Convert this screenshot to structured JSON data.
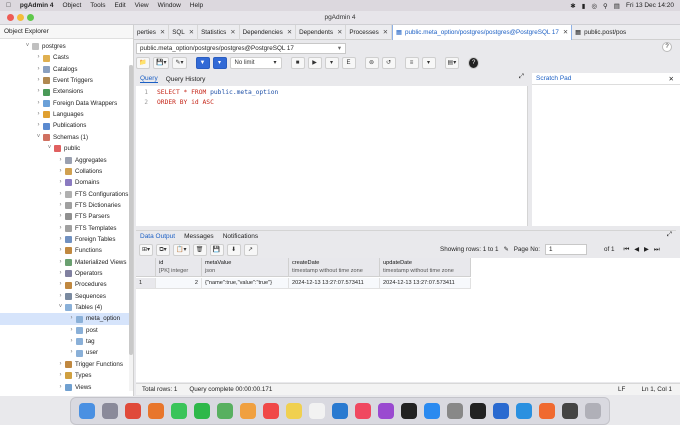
{
  "menubar": {
    "app": "pgAdmin 4",
    "items": [
      "Object",
      "Tools",
      "Edit",
      "View",
      "Window",
      "Help"
    ],
    "clock": "Fri 13 Dec 14:20"
  },
  "window": {
    "title": "pgAdmin 4"
  },
  "explorer": {
    "title": "Object Explorer",
    "tree": [
      {
        "label": "postgres",
        "depth": 1,
        "color": "#c0c0c0",
        "caret": "v"
      },
      {
        "label": "Casts",
        "depth": 2,
        "color": "#e0b050",
        "caret": ">"
      },
      {
        "label": "Catalogs",
        "depth": 2,
        "color": "#8aa0c0",
        "caret": ">"
      },
      {
        "label": "Event Triggers",
        "depth": 2,
        "color": "#b08850",
        "caret": ">"
      },
      {
        "label": "Extensions",
        "depth": 2,
        "color": "#4a9a58",
        "caret": ">"
      },
      {
        "label": "Foreign Data Wrappers",
        "depth": 2,
        "color": "#6aa0d8",
        "caret": ">"
      },
      {
        "label": "Languages",
        "depth": 2,
        "color": "#e0a030",
        "caret": ">"
      },
      {
        "label": "Publications",
        "depth": 2,
        "color": "#5a8ad0",
        "caret": ">"
      },
      {
        "label": "Schemas (1)",
        "depth": 2,
        "color": "#d07060",
        "caret": "v"
      },
      {
        "label": "public",
        "depth": 3,
        "color": "#e06060",
        "caret": "v"
      },
      {
        "label": "Aggregates",
        "depth": 4,
        "color": "#9aa0b0",
        "caret": ">"
      },
      {
        "label": "Collations",
        "depth": 4,
        "color": "#d0a050",
        "caret": ">"
      },
      {
        "label": "Domains",
        "depth": 4,
        "color": "#8a7ac0",
        "caret": ">"
      },
      {
        "label": "FTS Configurations",
        "depth": 4,
        "color": "#b0b0b0",
        "caret": ">"
      },
      {
        "label": "FTS Dictionaries",
        "depth": 4,
        "color": "#a0a0a0",
        "caret": ">"
      },
      {
        "label": "FTS Parsers",
        "depth": 4,
        "color": "#909090",
        "caret": ">"
      },
      {
        "label": "FTS Templates",
        "depth": 4,
        "color": "#a0a0a0",
        "caret": ">"
      },
      {
        "label": "Foreign Tables",
        "depth": 4,
        "color": "#7090c0",
        "caret": ">"
      },
      {
        "label": "Functions",
        "depth": 4,
        "color": "#c08840",
        "caret": ">"
      },
      {
        "label": "Materialized Views",
        "depth": 4,
        "color": "#6aa070",
        "caret": ">"
      },
      {
        "label": "Operators",
        "depth": 4,
        "color": "#8080a0",
        "caret": ">"
      },
      {
        "label": "Procedures",
        "depth": 4,
        "color": "#c08840",
        "caret": ">"
      },
      {
        "label": "Sequences",
        "depth": 4,
        "color": "#7a8aa0",
        "caret": ">"
      },
      {
        "label": "Tables (4)",
        "depth": 4,
        "color": "#8ab0d8",
        "caret": "v"
      },
      {
        "label": "meta_option",
        "depth": 5,
        "color": "#8ab0d8",
        "caret": ">",
        "selected": true
      },
      {
        "label": "post",
        "depth": 5,
        "color": "#8ab0d8",
        "caret": ">"
      },
      {
        "label": "tag",
        "depth": 5,
        "color": "#8ab0d8",
        "caret": ">"
      },
      {
        "label": "user",
        "depth": 5,
        "color": "#8ab0d8",
        "caret": ">"
      },
      {
        "label": "Trigger Functions",
        "depth": 4,
        "color": "#c08840",
        "caret": ">"
      },
      {
        "label": "Types",
        "depth": 4,
        "color": "#d0a040",
        "caret": ">"
      },
      {
        "label": "Views",
        "depth": 4,
        "color": "#70a0d0",
        "caret": ">"
      }
    ]
  },
  "tabs": [
    {
      "label": "perties",
      "active": false
    },
    {
      "label": "SQL",
      "active": false
    },
    {
      "label": "Statistics",
      "active": false
    },
    {
      "label": "Dependencies",
      "active": false
    },
    {
      "label": "Dependents",
      "active": false
    },
    {
      "label": "Processes",
      "active": false
    },
    {
      "label": "public.meta_option/postgres/postgres@PostgreSQL 17",
      "active": true
    },
    {
      "label": "public.post/pos",
      "active": false
    }
  ],
  "connection": {
    "label": "public.meta_option/postgres/postgres@PostgreSQL 17",
    "help": "?"
  },
  "toolbar": {
    "limit": "No limit"
  },
  "query": {
    "tabs": [
      "Query",
      "Query History"
    ],
    "lines": [
      {
        "num": "1",
        "parts": [
          {
            "t": "SELECT * FROM ",
            "c": "kw"
          },
          {
            "t": "public.meta_option",
            "c": "tbl"
          }
        ]
      },
      {
        "num": "2",
        "parts": [
          {
            "t": "ORDER BY id ASC",
            "c": "kw"
          }
        ]
      }
    ]
  },
  "scratch": {
    "title": "Scratch Pad"
  },
  "output": {
    "tabs": [
      "Data Output",
      "Messages",
      "Notifications"
    ],
    "rows_label": "Showing rows: 1 to 1",
    "page_label": "Page No:",
    "page_value": "1",
    "of_label": "of 1",
    "columns": [
      {
        "name": "id",
        "type": "[PK] integer"
      },
      {
        "name": "metaValue",
        "type": "json"
      },
      {
        "name": "createDate",
        "type": "timestamp without time zone"
      },
      {
        "name": "updateDate",
        "type": "timestamp without time zone"
      }
    ],
    "rows": [
      {
        "num": "1",
        "cells": [
          "2",
          "{\"name\":true,\"value\":\"true\"}",
          "2024-12-13 13:27:07.573411",
          "2024-12-13 13:27:07.573411"
        ]
      }
    ]
  },
  "status": {
    "total": "Total rows: 1",
    "query": "Query complete 00:00:00.171",
    "eol": "LF",
    "pos": "Ln 1, Col 1"
  },
  "dock": {
    "icons": [
      "finder-icon",
      "launchpad-icon",
      "chrome-icon",
      "firefox-icon",
      "messages-icon",
      "facetime-icon",
      "maps-icon",
      "photos-icon",
      "calendar-icon",
      "notes-icon",
      "reminders-icon",
      "vscode-icon",
      "music-icon",
      "podcasts-icon",
      "tv-icon",
      "app-store-icon",
      "settings-icon",
      "terminal-icon",
      "pgadmin-icon",
      "docker-icon",
      "postman-icon",
      "screenshot-icon",
      "trash-icon"
    ],
    "colors": [
      "#4a90e2",
      "#8a8a9a",
      "#e04a3a",
      "#e8762c",
      "#3ac45a",
      "#2eb84a",
      "#58b060",
      "#f0a040",
      "#f04848",
      "#f0d050",
      "#f2f2f2",
      "#2a7ad0",
      "#f04860",
      "#9a4ad0",
      "#222222",
      "#2a8af0",
      "#888888",
      "#222222",
      "#2a6ad0",
      "#2a90e0",
      "#f06a30",
      "#444444",
      "#b0b0b8"
    ]
  }
}
